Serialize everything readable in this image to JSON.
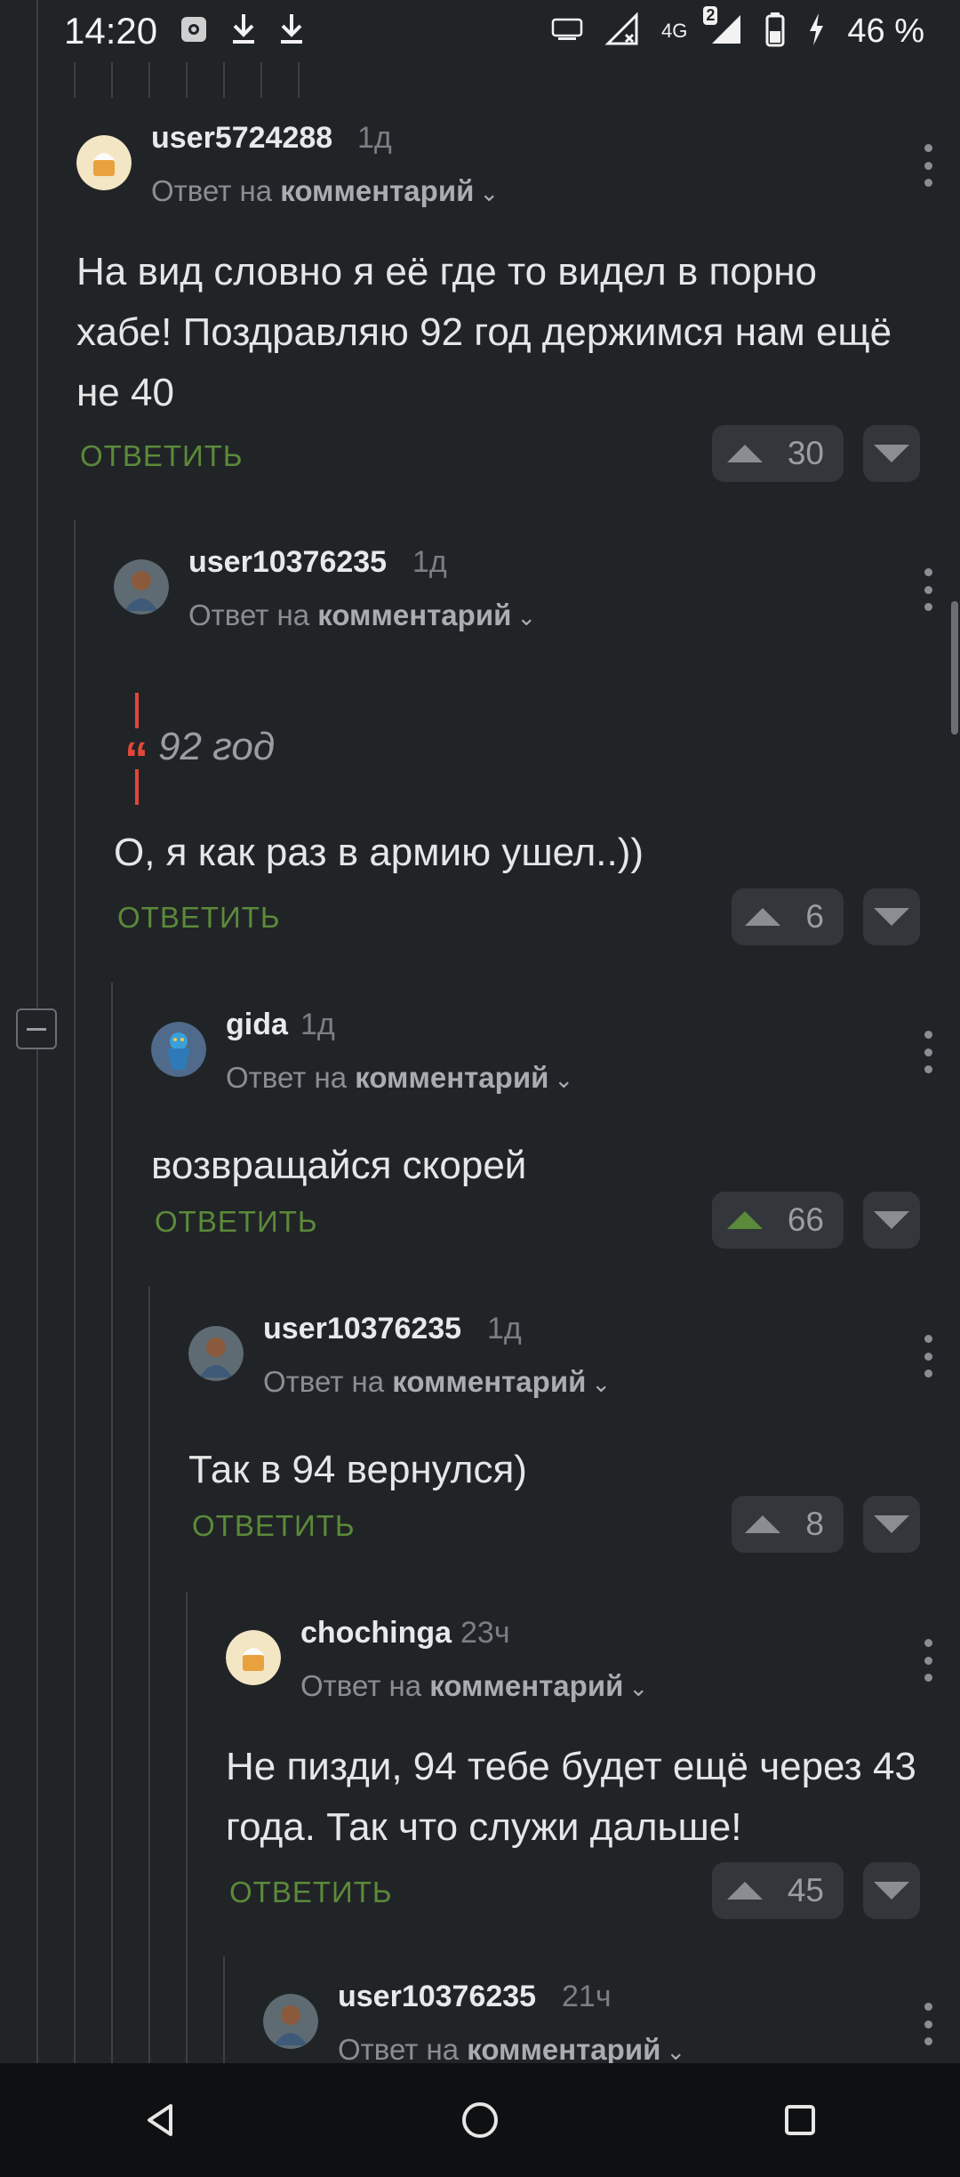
{
  "status_bar": {
    "time": "14:20",
    "icons": [
      "settings-icon",
      "download-icon",
      "download-icon",
      "auto-brightness-icon",
      "signal-x-icon",
      "lte-icon",
      "signal-icon",
      "battery-icon",
      "charging-icon"
    ],
    "network_label": "4G",
    "sim_badge": "2",
    "battery": "46 %"
  },
  "ui_text": {
    "reply_prefix": "Ответ на",
    "reply_target": "комментарий",
    "reply_button": "ОТВЕТИТЬ"
  },
  "comments": [
    {
      "username": "user5724288",
      "time": "1д",
      "text": "На вид словно я её где то видел в порно хабе! Поздравляю 92 год держимся нам ещё не 40",
      "votes": "30",
      "upvoted": false
    },
    {
      "username": "user10376235",
      "time": "1д",
      "quote": "92 год",
      "text": "О, я как раз в армию ушел..))",
      "votes": "6",
      "upvoted": false
    },
    {
      "username": "gida",
      "time": "1д",
      "text": "возвращайся скорей",
      "votes": "66",
      "upvoted": true
    },
    {
      "username": "user10376235",
      "time": "1д",
      "text": "Так в 94 вернулся)",
      "votes": "8",
      "upvoted": false
    },
    {
      "username": "chochinga",
      "time": "23ч",
      "text": "Не пизди, 94 тебе будет ещё через 43 года. Так что служи дальше!",
      "votes": "45",
      "upvoted": false
    },
    {
      "username": "user10376235",
      "time": "21ч"
    }
  ],
  "colors": {
    "background": "#212427",
    "accent_green": "#5b8a3a",
    "quote_red": "#e2473b",
    "muted": "#8a8e93"
  }
}
